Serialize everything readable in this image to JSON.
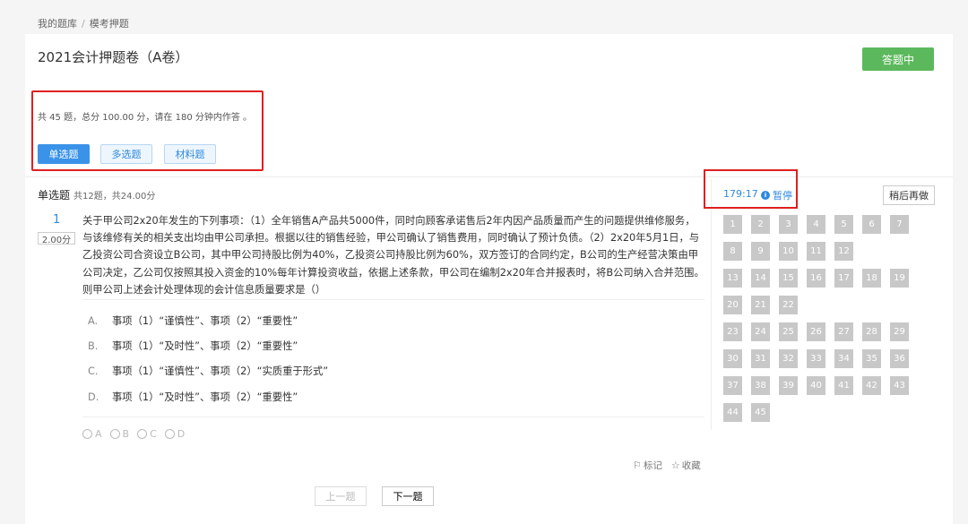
{
  "breadcrumb": {
    "home": "我的题库",
    "separator": "/",
    "current": "模考押题"
  },
  "page": {
    "title": "2021会计押题卷（A卷）",
    "status_button": "答题中",
    "accent_color": "#5cb85c"
  },
  "exam_info": {
    "summary": "共 45 题，总分 100.00 分，请在 180 分钟内作答 。",
    "question_types": [
      "单选题",
      "多选题",
      "材料题"
    ],
    "active_type": "单选题"
  },
  "section": {
    "title": "单选题",
    "subtitle": "共12题，共24.00分"
  },
  "question": {
    "number": "1",
    "score": "2.00分",
    "stem": "关于甲公司2x20年发生的下列事项：（1）全年销售A产品共5000件，同时向顾客承诺售后2年内因产品质量而产生的问题提供维修服务，与该维修有关的相关支出均由甲公司承担。根据以往的销售经验，甲公司确认了销售费用，同时确认了预计负债。（2）2x20年5月1日，与乙投资公司合资设立B公司，其中甲公司持股比例为40%，乙投资公司持股比例为60%，双方签订的合同约定，B公司的生产经营决策由甲公司决定，乙公司仅按照其投入资金的10%每年计算投资收益，依据上述条款，甲公司在编制2x20年合并报表时，将B公司纳入合并范围。则甲公司上述会计处理体现的会计信息质量要求是（）",
    "options": [
      {
        "letter": "A.",
        "text": "事项（1）“谨慎性”、事项（2）“重要性”"
      },
      {
        "letter": "B.",
        "text": "事项（1）“及时性”、事项（2）“重要性”"
      },
      {
        "letter": "C.",
        "text": "事项（1）“谨慎性”、事项（2）“实质重于形式”"
      },
      {
        "letter": "D.",
        "text": "事项（1）“及时性”、事项（2）“重要性”"
      }
    ],
    "answer_choices": [
      "A",
      "B",
      "C",
      "D"
    ],
    "mark_label": "标记",
    "favorite_label": "收藏"
  },
  "navigation": {
    "prev": "上一题",
    "next": "下一题"
  },
  "side_panel": {
    "timer": "179:17",
    "pause_label": "暂停",
    "later_button": "稍后再做",
    "question_groups": [
      [
        "1",
        "2",
        "3",
        "4",
        "5",
        "6",
        "7",
        "8",
        "9",
        "10",
        "11",
        "12"
      ],
      [
        "13",
        "14",
        "15",
        "16",
        "17",
        "18",
        "19",
        "20",
        "21",
        "22"
      ],
      [
        "23",
        "24",
        "25",
        "26",
        "27",
        "28",
        "29",
        "30",
        "31",
        "32",
        "33",
        "34",
        "35",
        "36",
        "37",
        "38",
        "39",
        "40",
        "41",
        "42",
        "43",
        "44",
        "45"
      ]
    ]
  },
  "colors": {
    "link": "#2f8ae0",
    "highlight_box": "#e02020",
    "cell": "#c8c8c8"
  },
  "icons": {
    "pause": "info-circle-icon",
    "mark": "flag-icon",
    "favorite": "star-icon"
  }
}
